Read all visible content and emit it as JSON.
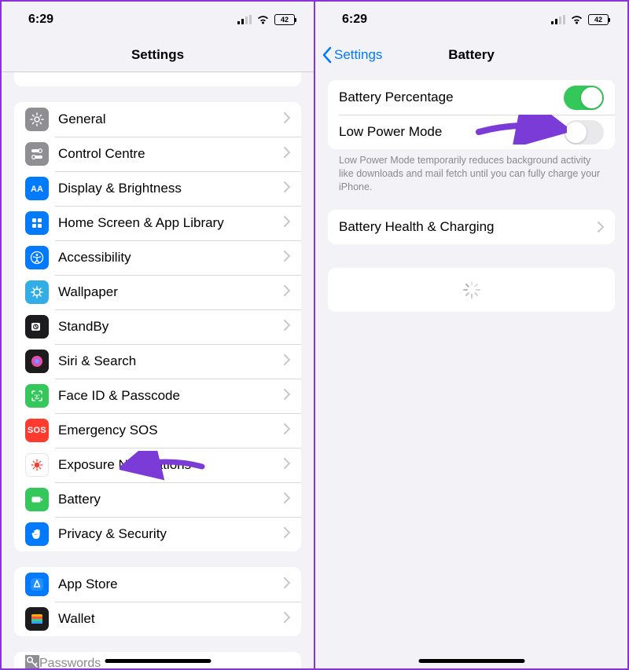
{
  "status": {
    "time": "6:29",
    "battery": "42"
  },
  "left": {
    "title": "Settings",
    "items": [
      {
        "label": "General",
        "icon": "gear-icon",
        "bg": "bg-gray"
      },
      {
        "label": "Control Centre",
        "icon": "toggles-icon",
        "bg": "bg-gray"
      },
      {
        "label": "Display & Brightness",
        "icon": "brightness-icon",
        "bg": "bg-blue"
      },
      {
        "label": "Home Screen & App Library",
        "icon": "homescreen-icon",
        "bg": "bg-blue"
      },
      {
        "label": "Accessibility",
        "icon": "accessibility-icon",
        "bg": "bg-blue"
      },
      {
        "label": "Wallpaper",
        "icon": "wallpaper-icon",
        "bg": "bg-cyan"
      },
      {
        "label": "StandBy",
        "icon": "standby-icon",
        "bg": "bg-black"
      },
      {
        "label": "Siri & Search",
        "icon": "siri-icon",
        "bg": "bg-black"
      },
      {
        "label": "Face ID & Passcode",
        "icon": "faceid-icon",
        "bg": "bg-green"
      },
      {
        "label": "Emergency SOS",
        "icon": "sos-icon",
        "bg": "bg-red"
      },
      {
        "label": "Exposure Notifications",
        "icon": "exposure-icon",
        "bg": "bg-white"
      },
      {
        "label": "Battery",
        "icon": "battery-icon",
        "bg": "bg-green"
      },
      {
        "label": "Privacy & Security",
        "icon": "hand-icon",
        "bg": "bg-blue"
      }
    ],
    "group2": [
      {
        "label": "App Store",
        "icon": "appstore-icon",
        "bg": "bg-blue"
      },
      {
        "label": "Wallet",
        "icon": "wallet-icon",
        "bg": "bg-black"
      }
    ],
    "peek_bottom": {
      "label": "Passwords",
      "icon": "key-icon",
      "bg": "bg-gray"
    }
  },
  "right": {
    "back": "Settings",
    "title": "Battery",
    "rows": {
      "percentage": {
        "label": "Battery Percentage",
        "on": true
      },
      "lowpower": {
        "label": "Low Power Mode",
        "on": false
      }
    },
    "footer": "Low Power Mode temporarily reduces background activity like downloads and mail fetch until you can fully charge your iPhone.",
    "health": "Battery Health & Charging"
  }
}
